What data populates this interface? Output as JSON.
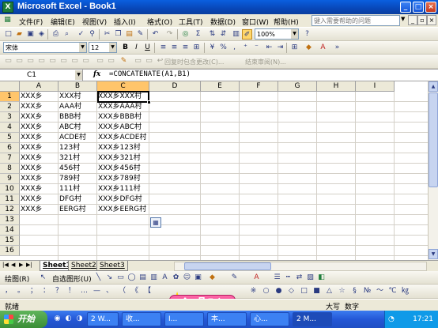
{
  "window": {
    "title": "Microsoft Excel - Book1",
    "minimize": "_",
    "maximize": "□",
    "close": "×"
  },
  "menu": {
    "items": [
      "文件(F)",
      "编辑(E)",
      "视图(V)",
      "插入(I)",
      "格式(O)",
      "工具(T)",
      "数据(D)",
      "窗口(W)",
      "帮助(H)"
    ],
    "help_placeholder": "键入需要帮助的问题"
  },
  "standard_toolbar": {
    "zoom": "100%"
  },
  "format_toolbar": {
    "font": "宋体",
    "size": "12",
    "bold": "B",
    "italic": "I",
    "underline": "U"
  },
  "reviewing_toolbar": {
    "reply_label": "回复时包含更改(C)...",
    "end_review_label": "结束审阅(N)..."
  },
  "formula_bar": {
    "name_box": "C1",
    "fx": "fx",
    "formula": "=CONCATENATE(A1,B1)"
  },
  "sheet": {
    "columns": [
      "A",
      "B",
      "C",
      "D",
      "E",
      "F",
      "G",
      "H",
      "I"
    ],
    "selected_column": "C",
    "selected_row": 1,
    "rows": [
      {
        "n": "1",
        "a": "XXX乡",
        "b": "XXX村",
        "c": "XXX乡XXX村"
      },
      {
        "n": "2",
        "a": "XXX乡",
        "b": "AAA村",
        "c": "XXX乡AAA村"
      },
      {
        "n": "3",
        "a": "XXX乡",
        "b": "BBB村",
        "c": "XXX乡BBB村"
      },
      {
        "n": "4",
        "a": "XXX乡",
        "b": "ABC村",
        "c": "XXX乡ABC村"
      },
      {
        "n": "5",
        "a": "XXX乡",
        "b": "ACDE村",
        "c": "XXX乡ACDE村"
      },
      {
        "n": "6",
        "a": "XXX乡",
        "b": "123村",
        "c": "XXX乡123村"
      },
      {
        "n": "7",
        "a": "XXX乡",
        "b": "321村",
        "c": "XXX乡321村"
      },
      {
        "n": "8",
        "a": "XXX乡",
        "b": "456村",
        "c": "XXX乡456村"
      },
      {
        "n": "9",
        "a": "XXX乡",
        "b": "789村",
        "c": "XXX乡789村"
      },
      {
        "n": "10",
        "a": "XXX乡",
        "b": "111村",
        "c": "XXX乡111村"
      },
      {
        "n": "11",
        "a": "XXX乡",
        "b": "DFG村",
        "c": "XXX乡DFG村"
      },
      {
        "n": "12",
        "a": "XXX乡",
        "b": "EERG村",
        "c": "XXX乡EERG村"
      },
      {
        "n": "13",
        "a": "",
        "b": "",
        "c": ""
      },
      {
        "n": "14",
        "a": "",
        "b": "",
        "c": ""
      },
      {
        "n": "15",
        "a": "",
        "b": "",
        "c": ""
      },
      {
        "n": "16",
        "a": "",
        "b": "",
        "c": ""
      }
    ]
  },
  "tabs": {
    "items": [
      "Sheet1",
      "Sheet2",
      "Sheet3"
    ],
    "active": "Sheet1"
  },
  "drawing_toolbar": {
    "draw": "绘图(R)",
    "autoshapes": "自选图形(U)"
  },
  "status": {
    "left": "就绪",
    "caps": "大写",
    "num": "数字"
  },
  "ime": {
    "label": "A ·, ◙ ≡ ♦"
  },
  "taskbar": {
    "start": "开始",
    "tasks": [
      "2 W...",
      "收...",
      "I...",
      "本...",
      "心...",
      "2 M..."
    ],
    "time": "17:21"
  }
}
